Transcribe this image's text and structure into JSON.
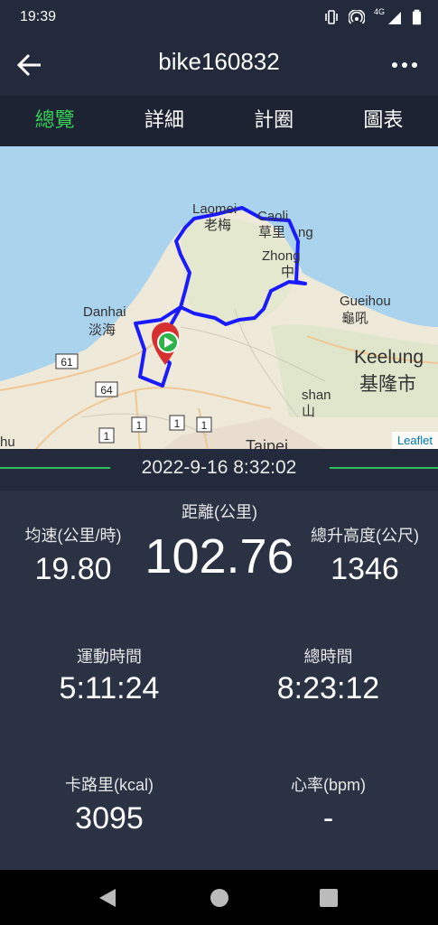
{
  "status": {
    "time": "19:39",
    "network": "4G"
  },
  "header": {
    "title": "bike160832"
  },
  "tabs": [
    {
      "label": "總覽",
      "active": true
    },
    {
      "label": "詳細",
      "active": false
    },
    {
      "label": "計圈",
      "active": false
    },
    {
      "label": "圖表",
      "active": false
    }
  ],
  "map": {
    "labels": {
      "laomei_en": "Laomei",
      "laomei_zh": "老梅",
      "caoli_en": "Caoli",
      "caoli_zh": "草里",
      "zhong_en": "Zhong",
      "zhong_zh": "中",
      "ng": "ng",
      "guihou_en": "Gueihou",
      "guihou_zh": "龜吼",
      "danhai_en": "Danhai",
      "danhai_zh": "淡海",
      "keelung_en": "Keelung",
      "keelung_zh": "基隆市",
      "shan": "shan",
      "shan_zh": "山",
      "taipei": "Taipei",
      "hu": "hu",
      "r61": "61",
      "r64": "64",
      "r1a": "1",
      "r1b": "1",
      "r1c": "1",
      "r1d": "1"
    },
    "attribution": "Leaflet",
    "route_color": "#1a1aff"
  },
  "date": "2022-9-16 8:32:02",
  "stats": {
    "avg_speed_label": "均速(公里/時)",
    "avg_speed": "19.80",
    "distance_label": "距離(公里)",
    "distance": "102.76",
    "elevation_label": "總升高度(公尺)",
    "elevation": "1346",
    "moving_time_label": "運動時間",
    "moving_time": "5:11:24",
    "total_time_label": "總時間",
    "total_time": "8:23:12",
    "calories_label": "卡路里(kcal)",
    "calories": "3095",
    "heart_rate_label": "心率(bpm)",
    "heart_rate": "-"
  },
  "colors": {
    "accent": "#34d058",
    "background": "#232a3b",
    "panel": "#2b3244"
  }
}
